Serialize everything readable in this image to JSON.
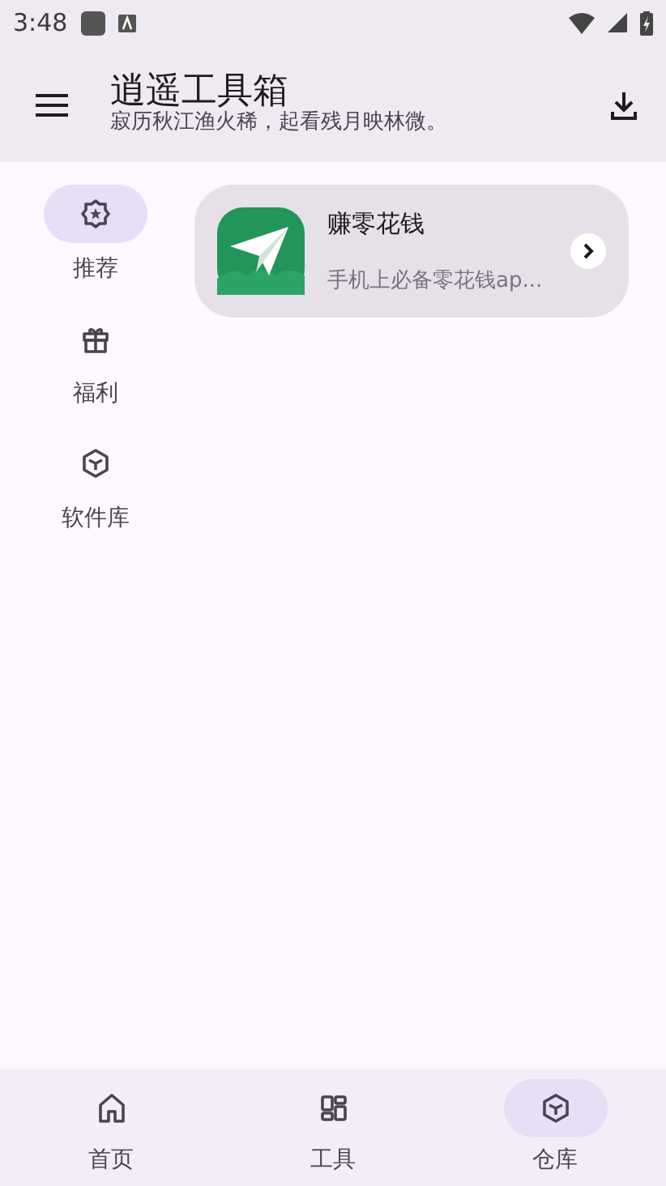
{
  "status_bar": {
    "time": "3:48"
  },
  "app_bar": {
    "title": "逍遥工具箱",
    "subtitle": "寂历秋江渔火稀，起看残月映林微。"
  },
  "rail": [
    {
      "kind": "star",
      "label": "推荐",
      "selected": true
    },
    {
      "kind": "gift",
      "label": "福利",
      "selected": false
    },
    {
      "kind": "cube",
      "label": "软件库",
      "selected": false
    }
  ],
  "apps": [
    {
      "name": "赚零花钱",
      "description": "手机上必备零花钱ap..."
    }
  ],
  "bottom_nav": [
    {
      "kind": "home",
      "label": "首页",
      "selected": false
    },
    {
      "kind": "grid",
      "label": "工具",
      "selected": false
    },
    {
      "kind": "cube",
      "label": "仓库",
      "selected": true
    }
  ]
}
